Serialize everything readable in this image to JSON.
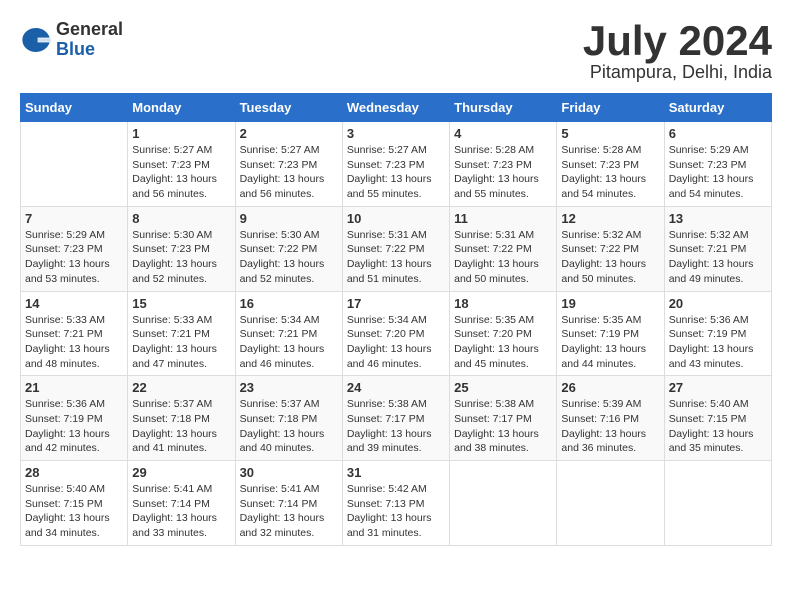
{
  "logo": {
    "general": "General",
    "blue": "Blue"
  },
  "title": {
    "month": "July 2024",
    "location": "Pitampura, Delhi, India"
  },
  "calendar": {
    "headers": [
      "Sunday",
      "Monday",
      "Tuesday",
      "Wednesday",
      "Thursday",
      "Friday",
      "Saturday"
    ],
    "rows": [
      [
        {
          "day": "",
          "info": ""
        },
        {
          "day": "1",
          "info": "Sunrise: 5:27 AM\nSunset: 7:23 PM\nDaylight: 13 hours\nand 56 minutes."
        },
        {
          "day": "2",
          "info": "Sunrise: 5:27 AM\nSunset: 7:23 PM\nDaylight: 13 hours\nand 56 minutes."
        },
        {
          "day": "3",
          "info": "Sunrise: 5:27 AM\nSunset: 7:23 PM\nDaylight: 13 hours\nand 55 minutes."
        },
        {
          "day": "4",
          "info": "Sunrise: 5:28 AM\nSunset: 7:23 PM\nDaylight: 13 hours\nand 55 minutes."
        },
        {
          "day": "5",
          "info": "Sunrise: 5:28 AM\nSunset: 7:23 PM\nDaylight: 13 hours\nand 54 minutes."
        },
        {
          "day": "6",
          "info": "Sunrise: 5:29 AM\nSunset: 7:23 PM\nDaylight: 13 hours\nand 54 minutes."
        }
      ],
      [
        {
          "day": "7",
          "info": "Sunrise: 5:29 AM\nSunset: 7:23 PM\nDaylight: 13 hours\nand 53 minutes."
        },
        {
          "day": "8",
          "info": "Sunrise: 5:30 AM\nSunset: 7:23 PM\nDaylight: 13 hours\nand 52 minutes."
        },
        {
          "day": "9",
          "info": "Sunrise: 5:30 AM\nSunset: 7:22 PM\nDaylight: 13 hours\nand 52 minutes."
        },
        {
          "day": "10",
          "info": "Sunrise: 5:31 AM\nSunset: 7:22 PM\nDaylight: 13 hours\nand 51 minutes."
        },
        {
          "day": "11",
          "info": "Sunrise: 5:31 AM\nSunset: 7:22 PM\nDaylight: 13 hours\nand 50 minutes."
        },
        {
          "day": "12",
          "info": "Sunrise: 5:32 AM\nSunset: 7:22 PM\nDaylight: 13 hours\nand 50 minutes."
        },
        {
          "day": "13",
          "info": "Sunrise: 5:32 AM\nSunset: 7:21 PM\nDaylight: 13 hours\nand 49 minutes."
        }
      ],
      [
        {
          "day": "14",
          "info": "Sunrise: 5:33 AM\nSunset: 7:21 PM\nDaylight: 13 hours\nand 48 minutes."
        },
        {
          "day": "15",
          "info": "Sunrise: 5:33 AM\nSunset: 7:21 PM\nDaylight: 13 hours\nand 47 minutes."
        },
        {
          "day": "16",
          "info": "Sunrise: 5:34 AM\nSunset: 7:21 PM\nDaylight: 13 hours\nand 46 minutes."
        },
        {
          "day": "17",
          "info": "Sunrise: 5:34 AM\nSunset: 7:20 PM\nDaylight: 13 hours\nand 46 minutes."
        },
        {
          "day": "18",
          "info": "Sunrise: 5:35 AM\nSunset: 7:20 PM\nDaylight: 13 hours\nand 45 minutes."
        },
        {
          "day": "19",
          "info": "Sunrise: 5:35 AM\nSunset: 7:19 PM\nDaylight: 13 hours\nand 44 minutes."
        },
        {
          "day": "20",
          "info": "Sunrise: 5:36 AM\nSunset: 7:19 PM\nDaylight: 13 hours\nand 43 minutes."
        }
      ],
      [
        {
          "day": "21",
          "info": "Sunrise: 5:36 AM\nSunset: 7:19 PM\nDaylight: 13 hours\nand 42 minutes."
        },
        {
          "day": "22",
          "info": "Sunrise: 5:37 AM\nSunset: 7:18 PM\nDaylight: 13 hours\nand 41 minutes."
        },
        {
          "day": "23",
          "info": "Sunrise: 5:37 AM\nSunset: 7:18 PM\nDaylight: 13 hours\nand 40 minutes."
        },
        {
          "day": "24",
          "info": "Sunrise: 5:38 AM\nSunset: 7:17 PM\nDaylight: 13 hours\nand 39 minutes."
        },
        {
          "day": "25",
          "info": "Sunrise: 5:38 AM\nSunset: 7:17 PM\nDaylight: 13 hours\nand 38 minutes."
        },
        {
          "day": "26",
          "info": "Sunrise: 5:39 AM\nSunset: 7:16 PM\nDaylight: 13 hours\nand 36 minutes."
        },
        {
          "day": "27",
          "info": "Sunrise: 5:40 AM\nSunset: 7:15 PM\nDaylight: 13 hours\nand 35 minutes."
        }
      ],
      [
        {
          "day": "28",
          "info": "Sunrise: 5:40 AM\nSunset: 7:15 PM\nDaylight: 13 hours\nand 34 minutes."
        },
        {
          "day": "29",
          "info": "Sunrise: 5:41 AM\nSunset: 7:14 PM\nDaylight: 13 hours\nand 33 minutes."
        },
        {
          "day": "30",
          "info": "Sunrise: 5:41 AM\nSunset: 7:14 PM\nDaylight: 13 hours\nand 32 minutes."
        },
        {
          "day": "31",
          "info": "Sunrise: 5:42 AM\nSunset: 7:13 PM\nDaylight: 13 hours\nand 31 minutes."
        },
        {
          "day": "",
          "info": ""
        },
        {
          "day": "",
          "info": ""
        },
        {
          "day": "",
          "info": ""
        }
      ]
    ]
  }
}
